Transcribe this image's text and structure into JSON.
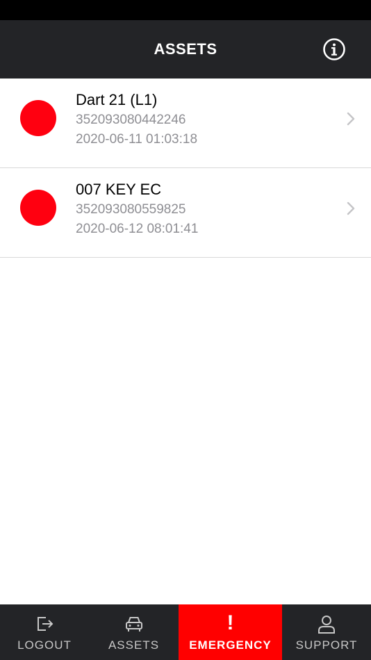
{
  "header": {
    "title": "ASSETS",
    "info_icon": "info-circle-icon"
  },
  "assets": [
    {
      "name": "Dart 21 (L1)",
      "id": "352093080442246",
      "timestamp": "2020-06-11 01:03:18",
      "status_color": "#ff0010"
    },
    {
      "name": "007 KEY EC",
      "id": "352093080559825",
      "timestamp": "2020-06-12 08:01:41",
      "status_color": "#ff0010"
    }
  ],
  "tabs": [
    {
      "label": "LOGOUT",
      "icon": "logout-icon"
    },
    {
      "label": "ASSETS",
      "icon": "car-icon"
    },
    {
      "label": "EMERGENCY",
      "icon": "exclamation-icon"
    },
    {
      "label": "SUPPORT",
      "icon": "person-icon"
    }
  ],
  "colors": {
    "bar": "#232427",
    "emergency": "#ff0000",
    "status_red": "#ff0010"
  }
}
